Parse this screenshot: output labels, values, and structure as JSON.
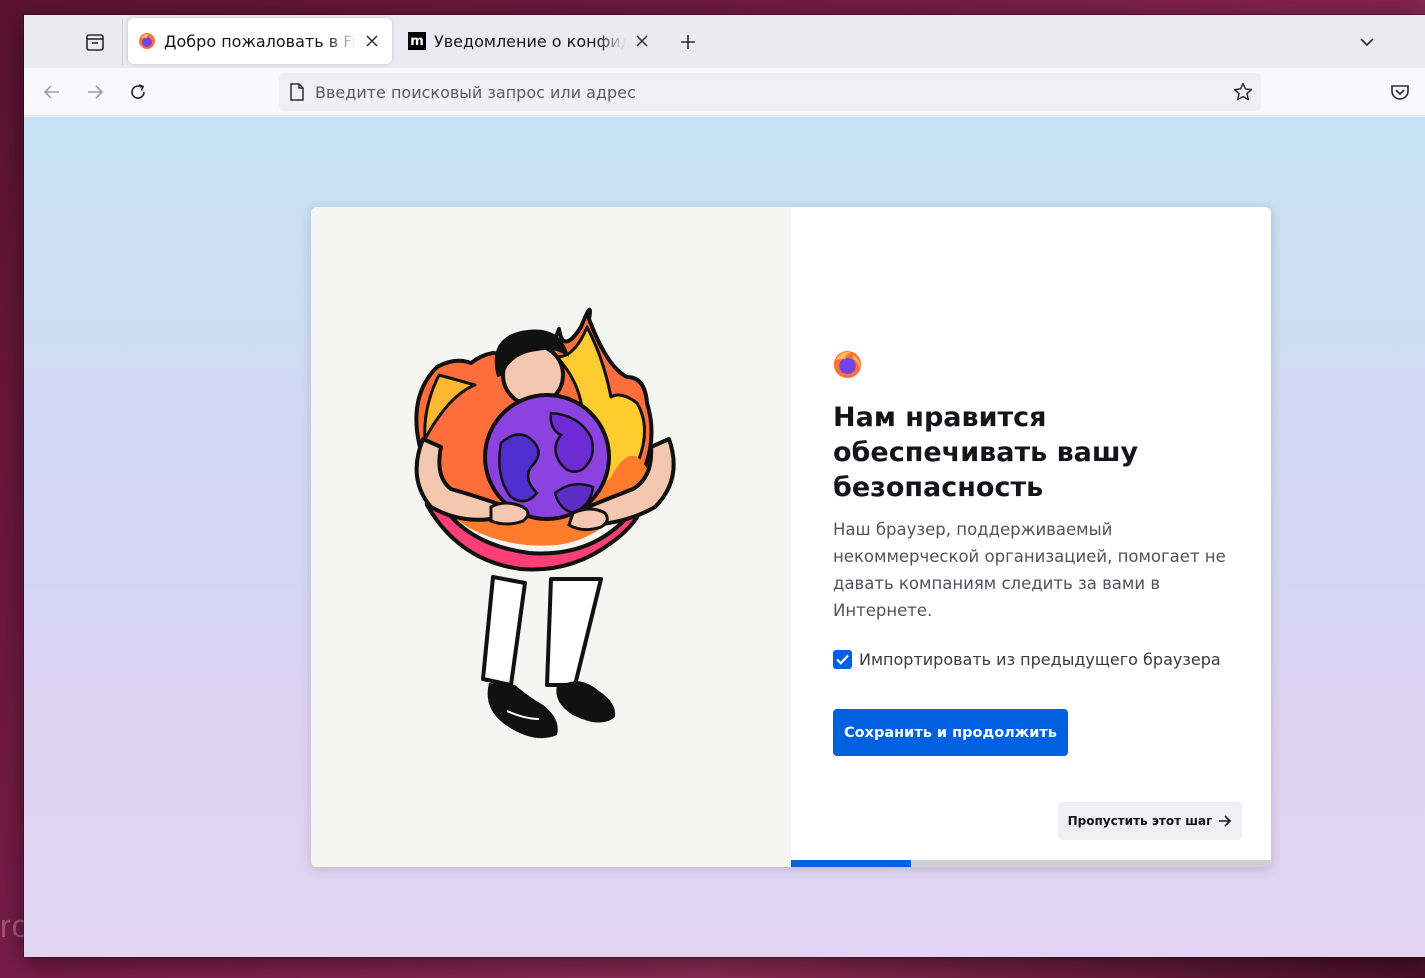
{
  "browser": {
    "tabs": [
      {
        "title": "Добро пожаловать в Firefox",
        "active": true,
        "favicon": "firefox-icon"
      },
      {
        "title": "Уведомление о конфиденциальности",
        "active": false,
        "favicon": "mozilla-m-icon"
      }
    ],
    "urlbar": {
      "placeholder": "Введите поисковый запрос или адрес"
    },
    "accent_color": "#0061e0"
  },
  "onboarding": {
    "heading": "Нам нравится обеспечивать вашу безопасность",
    "subtitle": "Наш браузер, поддерживаемый некоммерческой организацией, помогает не давать компаниям следить за вами в Интернете.",
    "import_checkbox": {
      "label": "Импортировать из предыдущего браузера",
      "checked": true
    },
    "primary_button": "Сохранить и продолжить",
    "skip_button": "Пропустить этот шаг",
    "progress": 0.25
  },
  "watermark": "rog.ru"
}
